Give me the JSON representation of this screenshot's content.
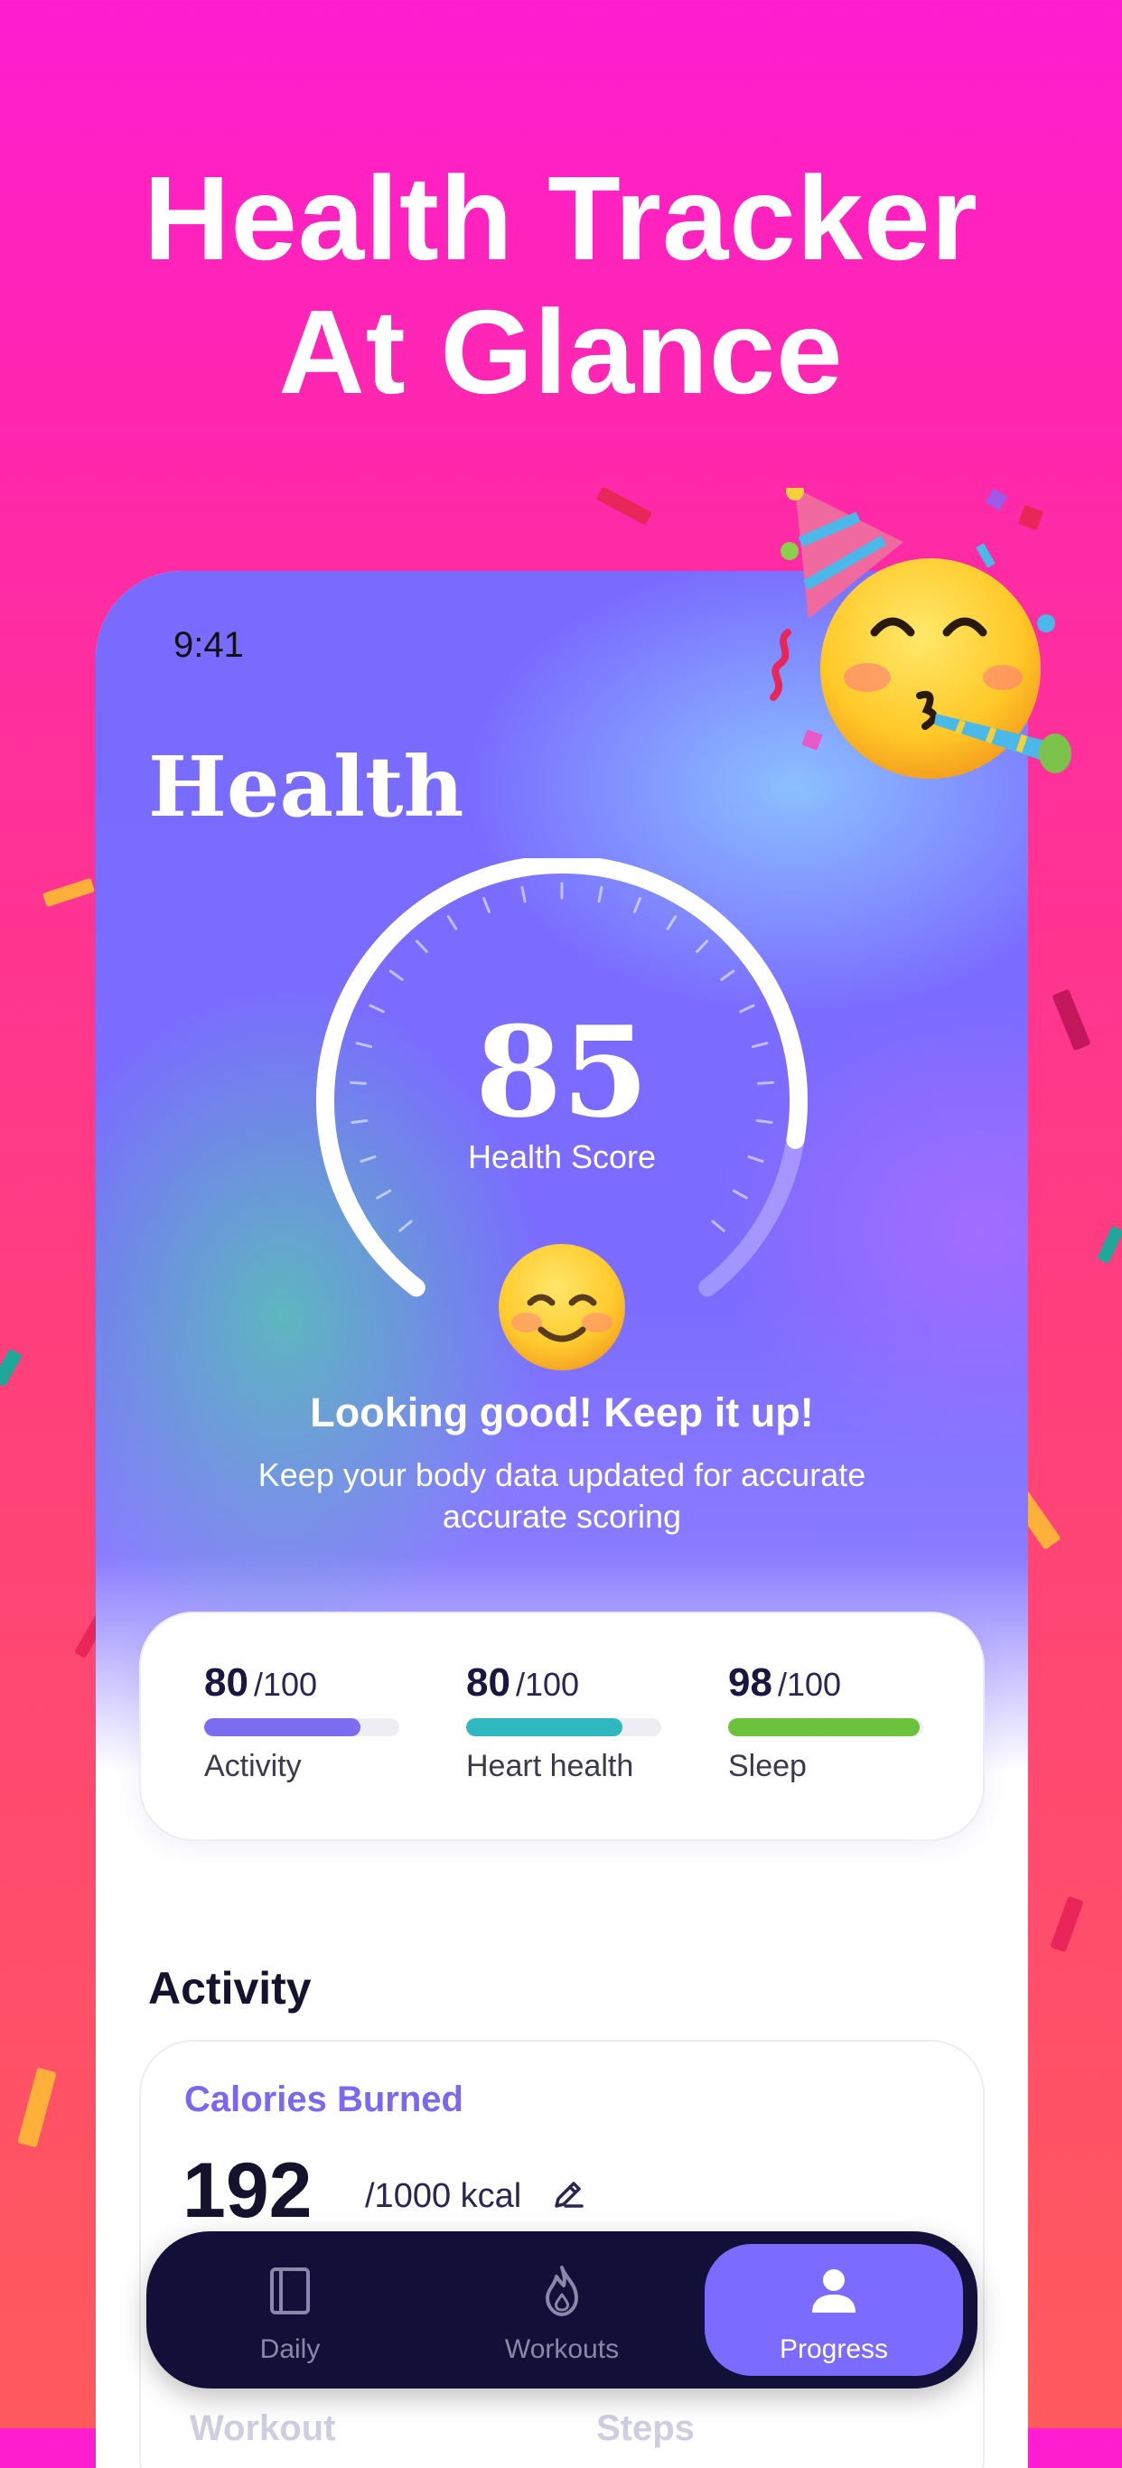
{
  "headline": {
    "line1": "Health Tracker",
    "line2": "At Glance"
  },
  "status_bar": {
    "time": "9:41"
  },
  "page": {
    "title": "Health"
  },
  "health_score": {
    "value": "85",
    "label": "Health Score",
    "fraction": 0.85,
    "message_title": "Looking good! Keep it up!",
    "message_body": "Keep your body data updated for accurate accurate scoring"
  },
  "scores": [
    {
      "value": "80",
      "max": "/100",
      "name": "Activity",
      "fraction": 0.8,
      "color": "#7b6cf0"
    },
    {
      "value": "80",
      "max": "/100",
      "name": "Heart health",
      "fraction": 0.8,
      "color": "#2fb8c0"
    },
    {
      "value": "98",
      "max": "/100",
      "name": "Sleep",
      "fraction": 0.98,
      "color": "#6cc23a"
    }
  ],
  "activity": {
    "section_title": "Activity",
    "calories": {
      "title": "Calories Burned",
      "value": "192",
      "unit": "/1000 kcal"
    },
    "peek_labels": [
      "Workout",
      "Steps"
    ]
  },
  "tabbar": {
    "tabs": [
      {
        "label": "Daily",
        "icon": "book-icon",
        "active": false
      },
      {
        "label": "Workouts",
        "icon": "flame-icon",
        "active": false
      },
      {
        "label": "Progress",
        "icon": "person-icon",
        "active": true
      }
    ]
  },
  "colors": {
    "accent": "#7b6cff",
    "tabbar_bg": "#121038",
    "background_top": "#ff1dd0",
    "background_bottom": "#ff5a5c"
  }
}
